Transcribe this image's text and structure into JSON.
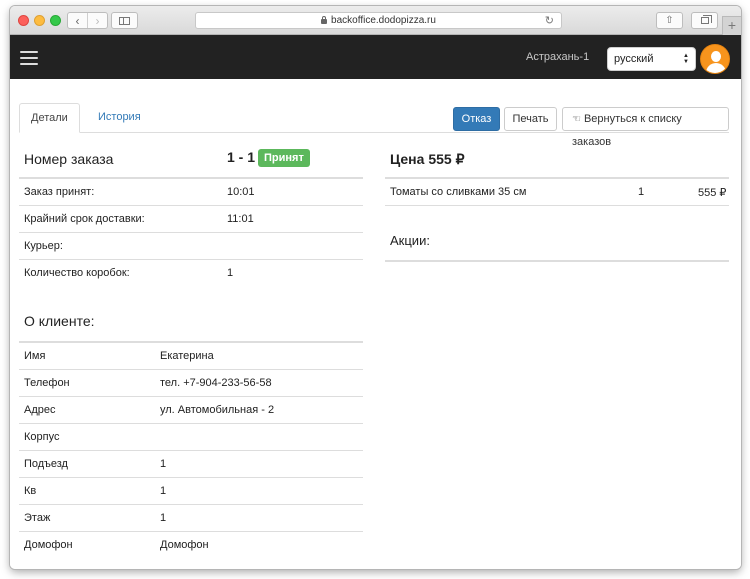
{
  "browser": {
    "url": "backoffice.dodopizza.ru",
    "back_glyph": "‹",
    "forward_glyph": "›",
    "reload_glyph": "↻",
    "share_glyph": "⇧",
    "newtab_glyph": "+"
  },
  "header": {
    "city": "Астрахань-1",
    "language": "русский",
    "accent_color": "#f7941d"
  },
  "tabs": [
    {
      "label": "Детали",
      "active": true
    },
    {
      "label": "История",
      "active": false
    }
  ],
  "actions": {
    "reject": "Отказ",
    "print": "Печать",
    "back_to_list": "Вернуться к списку заказов",
    "back_icon_glyph": "☜"
  },
  "order": {
    "title": "Номер заказа",
    "number": "1 - 1",
    "status": "Принят",
    "status_color": "#5cb85c",
    "details": [
      {
        "label": "Заказ принят:",
        "value": "10:01"
      },
      {
        "label": "Крайний срок доставки:",
        "value": "11:01"
      },
      {
        "label": "Курьер:",
        "value": ""
      },
      {
        "label": "Количество коробок:",
        "value": "1"
      }
    ]
  },
  "client": {
    "title": "О клиенте:",
    "rows": [
      {
        "label": "Имя",
        "value": "Екатерина"
      },
      {
        "label": "Телефон",
        "value": "тел. +7-904-233-56-58"
      },
      {
        "label": "Адрес",
        "value": "ул. Автомобильная - 2"
      },
      {
        "label": "Корпус",
        "value": ""
      },
      {
        "label": "Подъезд",
        "value": "1"
      },
      {
        "label": "Кв",
        "value": "1"
      },
      {
        "label": "Этаж",
        "value": "1"
      },
      {
        "label": "Домофон",
        "value": "Домофон"
      }
    ]
  },
  "price": {
    "title": "Цена 555 ₽",
    "items": [
      {
        "name": "Томаты со сливками 35 см",
        "qty": "1",
        "price": "555 ₽"
      }
    ],
    "promotions_title": "Акции:"
  }
}
